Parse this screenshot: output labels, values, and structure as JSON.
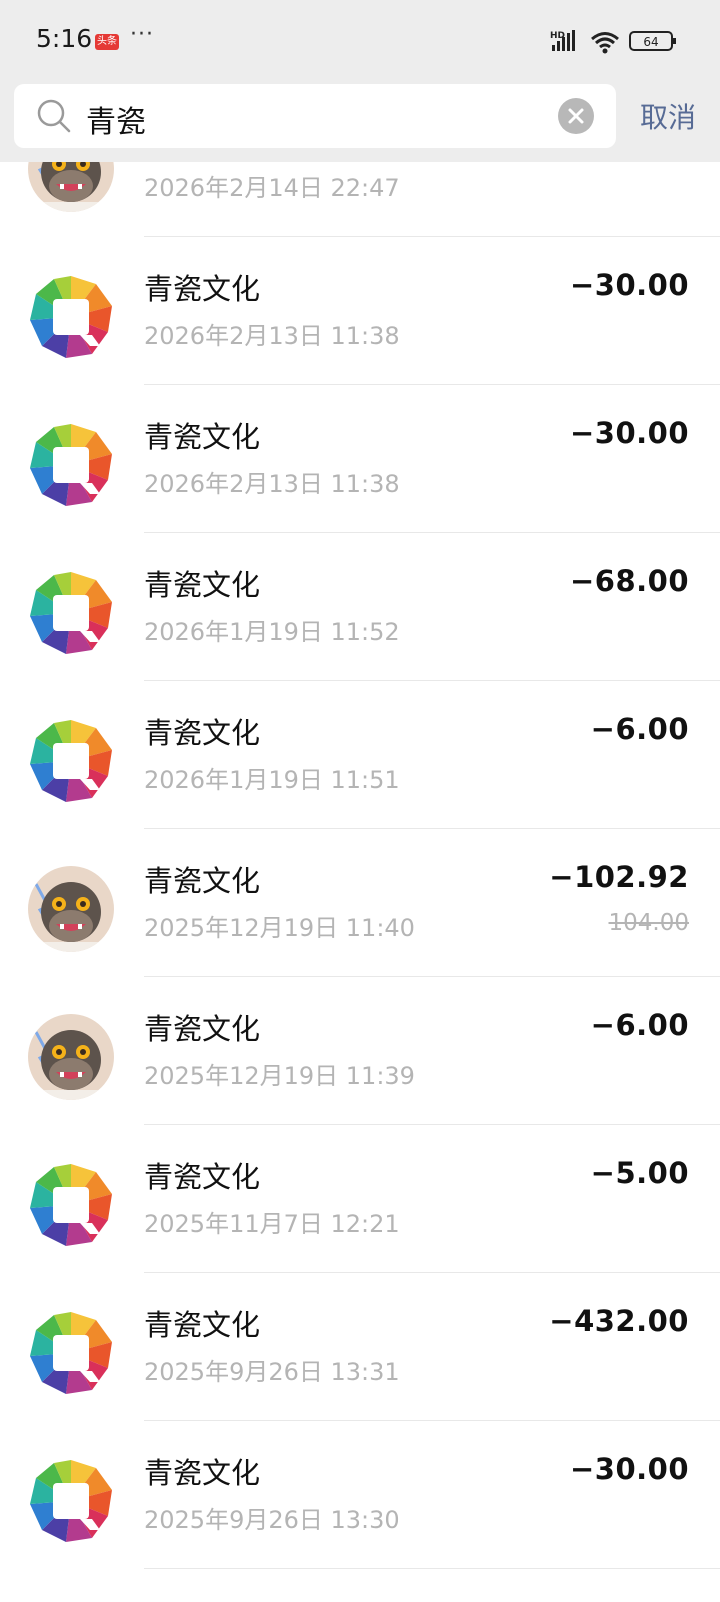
{
  "status_bar": {
    "time": "5:16",
    "news_badge": "头条",
    "more": "···",
    "battery": "64"
  },
  "search": {
    "query": "青瓷",
    "cancel_label": "取消"
  },
  "transactions": [
    {
      "title": "",
      "date": "2026年2月14日 22:47",
      "amount": "",
      "original": "",
      "avatar": "cartoon"
    },
    {
      "title": "青瓷文化",
      "date": "2026年2月13日 11:38",
      "amount": "−30.00",
      "original": "",
      "avatar": "logo"
    },
    {
      "title": "青瓷文化",
      "date": "2026年2月13日 11:38",
      "amount": "−30.00",
      "original": "",
      "avatar": "logo"
    },
    {
      "title": "青瓷文化",
      "date": "2026年1月19日 11:52",
      "amount": "−68.00",
      "original": "",
      "avatar": "logo"
    },
    {
      "title": "青瓷文化",
      "date": "2026年1月19日 11:51",
      "amount": "−6.00",
      "original": "",
      "avatar": "logo"
    },
    {
      "title": "青瓷文化",
      "date": "2025年12月19日 11:40",
      "amount": "−102.92",
      "original": "104.00",
      "avatar": "cartoon"
    },
    {
      "title": "青瓷文化",
      "date": "2025年12月19日 11:39",
      "amount": "−6.00",
      "original": "",
      "avatar": "cartoon"
    },
    {
      "title": "青瓷文化",
      "date": "2025年11月7日 12:21",
      "amount": "−5.00",
      "original": "",
      "avatar": "logo"
    },
    {
      "title": "青瓷文化",
      "date": "2025年9月26日 13:31",
      "amount": "−432.00",
      "original": "",
      "avatar": "logo"
    },
    {
      "title": "青瓷文化",
      "date": "2025年9月26日 13:30",
      "amount": "−30.00",
      "original": "",
      "avatar": "logo"
    }
  ],
  "colors": {
    "link": "#576b95",
    "muted": "#b4b4b4",
    "header_bg": "#ededed"
  }
}
